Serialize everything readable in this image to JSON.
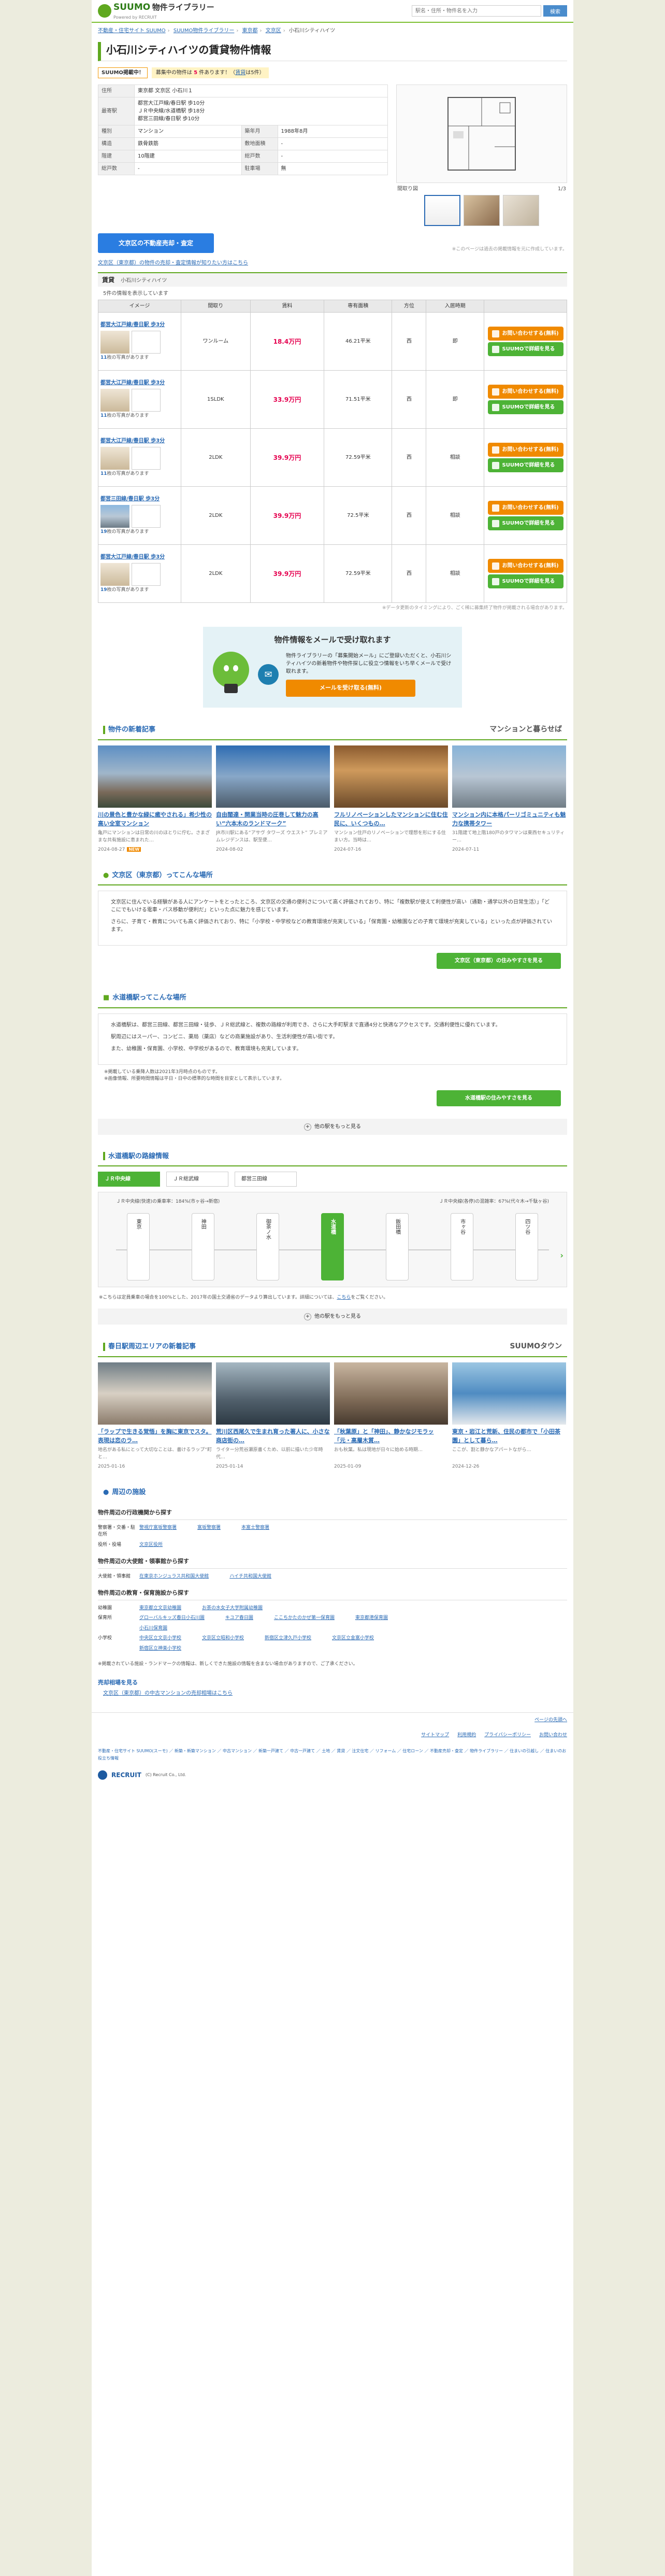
{
  "header": {
    "brand": "SUUMO",
    "product": "物件ライブラリー",
    "tagline": "Powered by RECRUIT",
    "search_placeholder": "駅名・住所・物件名を入力",
    "search_button": "検索"
  },
  "breadcrumb": [
    "不動産・住宅サイト SUUMO",
    "SUUMO物件ライブラリー",
    "東京都",
    "文京区",
    "小石川シティハイツ"
  ],
  "page_title": "小石川シティハイツの賃貸物件情報",
  "notice": {
    "badge": "SUUMO掲載中！",
    "msg_prefix": "募集中の物件は",
    "count": "5",
    "msg_mid": "件あります！",
    "msg_tail": "賃貸",
    "msg_end": "は5件"
  },
  "spec": [
    {
      "label": "住所",
      "value": "東京都 文京区 小石川１",
      "label2": "",
      "value2": ""
    },
    {
      "label": "最寄駅",
      "value": "都営大江戸線/春日駅 歩10分\nＪＲ中央線/水道橋駅 歩18分\n都営三田線/春日駅 歩10分",
      "label2": "",
      "value2": ""
    },
    {
      "label": "種別",
      "value": "マンション",
      "label2": "築年月",
      "value2": "1988年8月"
    },
    {
      "label": "構造",
      "value": "鉄骨鉄筋",
      "label2": "敷地面積",
      "value2": "‐"
    },
    {
      "label": "階建",
      "value": "10階建",
      "label2": "総戸数",
      "value2": "‐"
    },
    {
      "label": "総戸数",
      "value": "‐",
      "label2": "駐車場",
      "value2": "無"
    }
  ],
  "gallery": {
    "label": "間取り図",
    "counter": "1/3"
  },
  "cta": {
    "button": "文京区の不動産売却・査定",
    "note": "※このページは過去の掲載情報を元に作成しています。"
  },
  "top_link": "文京区（東京都）の物件の売却・査定情報が知りたい方はこちら",
  "rent": {
    "title": "賃貸",
    "building": "小石川シティハイツ",
    "count_line": "5件の情報を表示しています",
    "columns": [
      "イメージ",
      "間取り",
      "賃料",
      "専有面積",
      "方位",
      "入居時期",
      ""
    ],
    "rows": [
      {
        "name": "都営大江戸線/春日駅 歩3分",
        "layout": "ワンルーム",
        "rent": "18.4万円",
        "area": "46.21平米",
        "dir": "西",
        "move": "即",
        "photos": "11",
        "photos_label": "枚の写真があります"
      },
      {
        "name": "都営大江戸線/春日駅 歩3分",
        "layout": "1SLDK",
        "rent": "33.9万円",
        "area": "71.51平米",
        "dir": "西",
        "move": "即",
        "photos": "11",
        "photos_label": "枚の写真があります"
      },
      {
        "name": "都営大江戸線/春日駅 歩3分",
        "layout": "2LDK",
        "rent": "39.9万円",
        "area": "72.59平米",
        "dir": "西",
        "move": "相談",
        "photos": "11",
        "photos_label": "枚の写真があります"
      },
      {
        "name": "都営三田線/春日駅 歩3分",
        "layout": "2LDK",
        "rent": "39.9万円",
        "area": "72.5平米",
        "dir": "西",
        "move": "相談",
        "photos": "19",
        "photos_label": "枚の写真があります"
      },
      {
        "name": "都営大江戸線/春日駅 歩3分",
        "layout": "2LDK",
        "rent": "39.9万円",
        "area": "72.59平米",
        "dir": "西",
        "move": "相談",
        "photos": "19",
        "photos_label": "枚の写真があります"
      }
    ],
    "btn_inquiry": "お問い合わせする(無料)",
    "btn_detail": "SUUMOで詳細を見る",
    "table_note": "※データ更新のタイミングにより、ごく稀に募集終了物件が掲載される場合があります。"
  },
  "mail": {
    "title": "物件情報をメールで受け取れます",
    "body": "物件ライブラリーの「募集開始メール」にご登録いただくと、小石川シティハイツの新着物件や物件探しに役立つ情報をいち早くメールで受け取れます。",
    "button": "メールを受け取る(無料)"
  },
  "articles_section": {
    "title": "物件の新着記事",
    "partner": "マンションと暮らせば",
    "items": [
      {
        "title": "川の景色と豊かな緑に癒やされる」希少性の高い全室マンション",
        "desc": "亀戸にマンションは日常の川のほとりに佇む。さまざまな共有施設に恵まれた…",
        "date": "2024-08-27",
        "new": "NEW"
      },
      {
        "title": "自由闊達・開業当時の圧巻して魅力の高い“六本木のランドマーク”",
        "desc": "JR市川駅にある“アサヴ タワーズ ウエスト” プレミアムレジデンスは、駅至便…",
        "date": "2024-08-02",
        "new": ""
      },
      {
        "title": "フルリノベーションしたマンションに住む住民に、いくつもの…",
        "desc": "マンション住戸のリノベーションで理想を形にする住まい方。当時は…",
        "date": "2024-07-16",
        "new": ""
      },
      {
        "title": "マンション内に本格パーリゴミュニティも魅力な携帯タワー",
        "desc": "31階建て地上階180戸のタワマンは東西セキュリティー…",
        "date": "2024-07-11",
        "new": ""
      }
    ]
  },
  "area": {
    "title": "文京区（東京都）ってこんな場所",
    "p1": "文京区に住んでいる経験がある人にアンケートをとったところ、文京区の交通の便利さについて高く評価されており、特に「複数駅が使えて利便性が高い（通勤・通学以外の日常生活）」「どこにでもいける電車・バス移動が便利だ」といった点に魅力を感じています。",
    "p2": "さらに、子育て・教育についても高く評価されており、特に「小学校・中学校などの教育環境が充実している」「保育園・幼稚園などの子育て環境が充実している」といった点が評価されています。",
    "button": "文京区（東京都）の住みやすさを見る"
  },
  "station_info": {
    "title": "水道橋駅ってこんな場所",
    "p1": "水道橋駅は、都営三田線、都営三田線・徒歩、ＪＲ総武線と、複数の路線が利用でき、さらに大手町駅まで直通4分と快適なアクセスです。交通利便性に優れています。",
    "p2": "駅周辺にはスーパー、コンビニ、薬局（薬店）などの商業施設があり、生活利便性が高い街です。",
    "p3": "また、幼稚園・保育園、小学校、中学校があるので、教育環境も充実しています。",
    "note1": "※掲載している乗降人数は2021年3月時点のものです。",
    "note2": "※画像情報、所要時間情報は平日・日中の標準的な時間を目安として表示しています。",
    "button": "水道橋駅の住みやすさを見る",
    "more": "他の駅をもっと見る"
  },
  "routes": {
    "title": "水道橋駅の路線情報",
    "tabs": [
      "ＪＲ中央線",
      "ＪＲ総武線",
      "都営三田線"
    ],
    "meta_left": "ＪＲ中央線(快速)の乗車率：184%(市ヶ谷→新宿)",
    "meta_right": "ＪＲ中央線(各停)の混雑率：67%(代々木→千駄ヶ谷)",
    "stations": [
      "東京",
      "神田",
      "御茶ノ水",
      "水道橋",
      "飯田橋",
      "市ヶ谷",
      "四ツ谷"
    ],
    "active_station": "水道橋",
    "note": "※こちらは定員乗車の場合を100%とした、2017年の国土交通省のデータより算出しています。詳細については、",
    "note_link": "こちら",
    "note_end": "をご覧ください。",
    "more": "他の駅をもっと見る"
  },
  "town_articles": {
    "title": "春日駅周辺エリアの新着記事",
    "partner": "SUUMOタウン",
    "items": [
      {
        "title": "「ラップで生きる覚悟」を胸に東京でスタ。表現は恋のラ…",
        "desc": "地名がある私にとって大切なことは、書けるラップ“町と…",
        "date": "2025-01-16"
      },
      {
        "title": "荒川区西尾久で生まれ育った著人に、小さな商店街の…",
        "desc": "ライター分荒谷瀬原書くため、以前に描いた少年時代…",
        "date": "2025-01-14"
      },
      {
        "title": "「秋葉原」と「神田」、静かなジモラッ「元・高層木質…",
        "desc": "おも秋葉。私は現地が日々に始める時期…",
        "date": "2025-01-09"
      },
      {
        "title": "東京・岩江と荒新、住民の都市で「小田茶園」として暮ら…",
        "desc": "ここが、割と静かなアパートながら…",
        "date": "2024-12-26"
      }
    ]
  },
  "spots": {
    "title": "周辺の施設",
    "groups": [
      {
        "heading": "物件周辺の行政機関から探す",
        "rows": [
          {
            "label": "警察署・交番・駐在所",
            "items": [
              "警視庁富坂警察署",
              "富坂警察署",
              "本富士警察署"
            ]
          },
          {
            "label": "役所・役場",
            "items": [
              "文京区役所"
            ]
          }
        ]
      },
      {
        "heading": "物件周辺の大使館・領事館から探す",
        "rows": [
          {
            "label": "大使館・領事館",
            "items": [
              "在東京ホンジュラス共和国大使館",
              "ハイチ共和国大使館"
            ]
          }
        ]
      },
      {
        "heading": "物件周辺の教育・保育施設から探す",
        "rows": [
          {
            "label": "幼稚園",
            "items": [
              "東京都立文京幼稚園",
              "お茶の水女子大学附属幼稚園"
            ]
          },
          {
            "label": "保育所",
            "items": [
              "グローバルキッズ春日小石川園",
              "キユア春日園",
              "ここちかたのかぜ第一保育園",
              "東京都港保育園"
            ]
          },
          {
            "label": "",
            "items": [
              "小石川保育園"
            ]
          },
          {
            "label": "小学校",
            "items": [
              "中央区立文京小学校",
              "文京区立昭和小学校",
              "新宿区立津久戸小学校",
              "文京区立金富小学校"
            ]
          },
          {
            "label": "",
            "items": [
              "新宿区立神楽小学校"
            ]
          }
        ]
      }
    ],
    "note": "※掲載されている施設・ランドマークの情報は、新しくできた施設の情報を含まない場合がありますので、ご了承ください。"
  },
  "sub_links": {
    "heading": "売却相場を見る",
    "link": "文京区（東京都）の中古マンションの売却相場はこちら"
  },
  "page_top": "ページの先頭へ",
  "foot_links": [
    "サイトマップ",
    "利用規約",
    "プライバシーポリシー",
    "お問い合わせ"
  ],
  "footer_text": "不動産・住宅サイト SUUMO(スーモ) ／ 新築・新築マンション ／ 中古マンション ／ 新築一戸建て ／ 中古一戸建て ／ 土地 ／ 賃貸 ／ 注文住宅 ／ リフォーム ／ 住宅ローン ／ 不動産売却・査定 ／ 物件ライブラリー ／ 住まいの引越し ／ 住まいのお役立ち情報",
  "copyright": "(C) Recruit Co., Ltd.",
  "recruit": "RECRUIT"
}
